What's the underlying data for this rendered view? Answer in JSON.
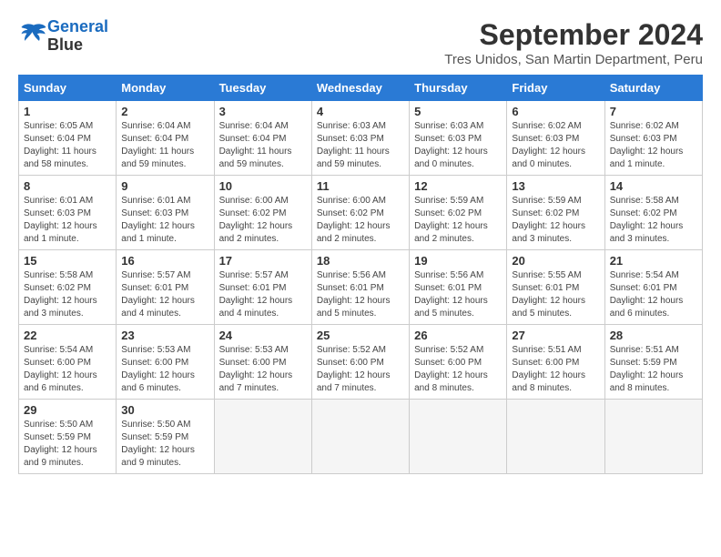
{
  "header": {
    "logo_line1": "General",
    "logo_line2": "Blue",
    "month": "September 2024",
    "subtitle": "Tres Unidos, San Martin Department, Peru"
  },
  "weekdays": [
    "Sunday",
    "Monday",
    "Tuesday",
    "Wednesday",
    "Thursday",
    "Friday",
    "Saturday"
  ],
  "weeks": [
    [
      {
        "day": "1",
        "info": "Sunrise: 6:05 AM\nSunset: 6:04 PM\nDaylight: 11 hours\nand 58 minutes."
      },
      {
        "day": "2",
        "info": "Sunrise: 6:04 AM\nSunset: 6:04 PM\nDaylight: 11 hours\nand 59 minutes."
      },
      {
        "day": "3",
        "info": "Sunrise: 6:04 AM\nSunset: 6:04 PM\nDaylight: 11 hours\nand 59 minutes."
      },
      {
        "day": "4",
        "info": "Sunrise: 6:03 AM\nSunset: 6:03 PM\nDaylight: 11 hours\nand 59 minutes."
      },
      {
        "day": "5",
        "info": "Sunrise: 6:03 AM\nSunset: 6:03 PM\nDaylight: 12 hours\nand 0 minutes."
      },
      {
        "day": "6",
        "info": "Sunrise: 6:02 AM\nSunset: 6:03 PM\nDaylight: 12 hours\nand 0 minutes."
      },
      {
        "day": "7",
        "info": "Sunrise: 6:02 AM\nSunset: 6:03 PM\nDaylight: 12 hours\nand 1 minute."
      }
    ],
    [
      {
        "day": "8",
        "info": "Sunrise: 6:01 AM\nSunset: 6:03 PM\nDaylight: 12 hours\nand 1 minute."
      },
      {
        "day": "9",
        "info": "Sunrise: 6:01 AM\nSunset: 6:03 PM\nDaylight: 12 hours\nand 1 minute."
      },
      {
        "day": "10",
        "info": "Sunrise: 6:00 AM\nSunset: 6:02 PM\nDaylight: 12 hours\nand 2 minutes."
      },
      {
        "day": "11",
        "info": "Sunrise: 6:00 AM\nSunset: 6:02 PM\nDaylight: 12 hours\nand 2 minutes."
      },
      {
        "day": "12",
        "info": "Sunrise: 5:59 AM\nSunset: 6:02 PM\nDaylight: 12 hours\nand 2 minutes."
      },
      {
        "day": "13",
        "info": "Sunrise: 5:59 AM\nSunset: 6:02 PM\nDaylight: 12 hours\nand 3 minutes."
      },
      {
        "day": "14",
        "info": "Sunrise: 5:58 AM\nSunset: 6:02 PM\nDaylight: 12 hours\nand 3 minutes."
      }
    ],
    [
      {
        "day": "15",
        "info": "Sunrise: 5:58 AM\nSunset: 6:02 PM\nDaylight: 12 hours\nand 3 minutes."
      },
      {
        "day": "16",
        "info": "Sunrise: 5:57 AM\nSunset: 6:01 PM\nDaylight: 12 hours\nand 4 minutes."
      },
      {
        "day": "17",
        "info": "Sunrise: 5:57 AM\nSunset: 6:01 PM\nDaylight: 12 hours\nand 4 minutes."
      },
      {
        "day": "18",
        "info": "Sunrise: 5:56 AM\nSunset: 6:01 PM\nDaylight: 12 hours\nand 5 minutes."
      },
      {
        "day": "19",
        "info": "Sunrise: 5:56 AM\nSunset: 6:01 PM\nDaylight: 12 hours\nand 5 minutes."
      },
      {
        "day": "20",
        "info": "Sunrise: 5:55 AM\nSunset: 6:01 PM\nDaylight: 12 hours\nand 5 minutes."
      },
      {
        "day": "21",
        "info": "Sunrise: 5:54 AM\nSunset: 6:01 PM\nDaylight: 12 hours\nand 6 minutes."
      }
    ],
    [
      {
        "day": "22",
        "info": "Sunrise: 5:54 AM\nSunset: 6:00 PM\nDaylight: 12 hours\nand 6 minutes."
      },
      {
        "day": "23",
        "info": "Sunrise: 5:53 AM\nSunset: 6:00 PM\nDaylight: 12 hours\nand 6 minutes."
      },
      {
        "day": "24",
        "info": "Sunrise: 5:53 AM\nSunset: 6:00 PM\nDaylight: 12 hours\nand 7 minutes."
      },
      {
        "day": "25",
        "info": "Sunrise: 5:52 AM\nSunset: 6:00 PM\nDaylight: 12 hours\nand 7 minutes."
      },
      {
        "day": "26",
        "info": "Sunrise: 5:52 AM\nSunset: 6:00 PM\nDaylight: 12 hours\nand 8 minutes."
      },
      {
        "day": "27",
        "info": "Sunrise: 5:51 AM\nSunset: 6:00 PM\nDaylight: 12 hours\nand 8 minutes."
      },
      {
        "day": "28",
        "info": "Sunrise: 5:51 AM\nSunset: 5:59 PM\nDaylight: 12 hours\nand 8 minutes."
      }
    ],
    [
      {
        "day": "29",
        "info": "Sunrise: 5:50 AM\nSunset: 5:59 PM\nDaylight: 12 hours\nand 9 minutes."
      },
      {
        "day": "30",
        "info": "Sunrise: 5:50 AM\nSunset: 5:59 PM\nDaylight: 12 hours\nand 9 minutes."
      },
      {
        "day": "",
        "info": ""
      },
      {
        "day": "",
        "info": ""
      },
      {
        "day": "",
        "info": ""
      },
      {
        "day": "",
        "info": ""
      },
      {
        "day": "",
        "info": ""
      }
    ]
  ]
}
